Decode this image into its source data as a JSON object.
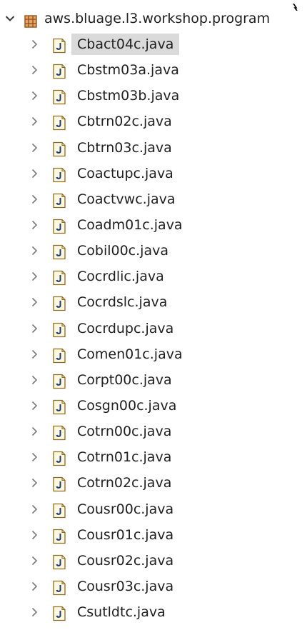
{
  "package": {
    "label": "aws.bluage.l3.workshop.program",
    "icon": "package-icon",
    "expanded": true
  },
  "files": [
    {
      "label": "Cbact04c.java",
      "selected": true
    },
    {
      "label": "Cbstm03a.java",
      "selected": false
    },
    {
      "label": "Cbstm03b.java",
      "selected": false
    },
    {
      "label": "Cbtrn02c.java",
      "selected": false
    },
    {
      "label": "Cbtrn03c.java",
      "selected": false
    },
    {
      "label": "Coactupc.java",
      "selected": false
    },
    {
      "label": "Coactvwc.java",
      "selected": false
    },
    {
      "label": "Coadm01c.java",
      "selected": false
    },
    {
      "label": "Cobil00c.java",
      "selected": false
    },
    {
      "label": "Cocrdlic.java",
      "selected": false
    },
    {
      "label": "Cocrdslc.java",
      "selected": false
    },
    {
      "label": "Cocrdupc.java",
      "selected": false
    },
    {
      "label": "Comen01c.java",
      "selected": false
    },
    {
      "label": "Corpt00c.java",
      "selected": false
    },
    {
      "label": "Cosgn00c.java",
      "selected": false
    },
    {
      "label": "Cotrn00c.java",
      "selected": false
    },
    {
      "label": "Cotrn01c.java",
      "selected": false
    },
    {
      "label": "Cotrn02c.java",
      "selected": false
    },
    {
      "label": "Cousr00c.java",
      "selected": false
    },
    {
      "label": "Cousr01c.java",
      "selected": false
    },
    {
      "label": "Cousr02c.java",
      "selected": false
    },
    {
      "label": "Cousr03c.java",
      "selected": false
    },
    {
      "label": "Csutldtc.java",
      "selected": false
    }
  ],
  "colors": {
    "selection": "#dadada",
    "package_icon": "#b5651d",
    "java_icon_fill": "#fff8e0",
    "java_icon_stroke": "#8a6d1f",
    "java_letter": "#1b3c73",
    "chevron": "#707070"
  },
  "icons": {
    "expanded": "chevron-down-icon",
    "collapsed": "chevron-right-icon",
    "file": "java-file-icon"
  }
}
